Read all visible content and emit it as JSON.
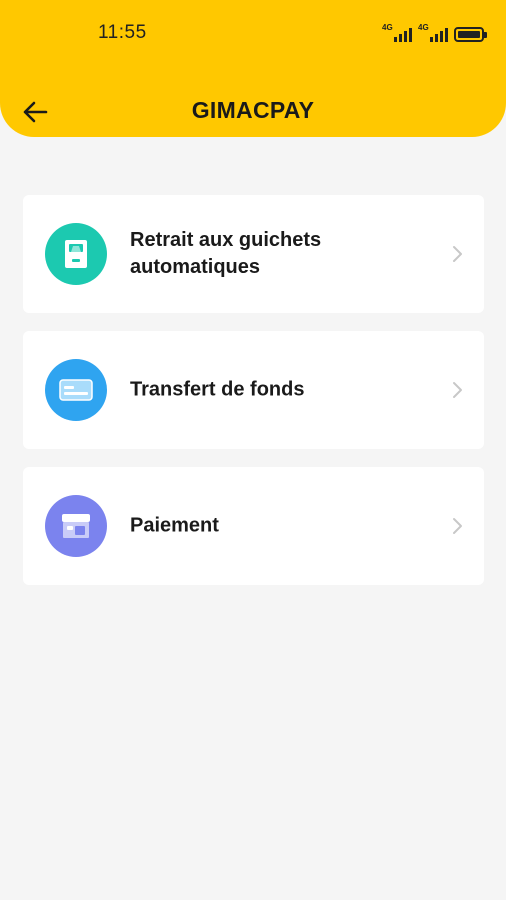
{
  "status_bar": {
    "time": "11:55",
    "network_1": "4G",
    "network_2": "4G",
    "icons": [
      "signal-icon",
      "signal-icon",
      "battery-icon"
    ]
  },
  "header": {
    "back_icon": "arrow-left-icon",
    "title": "GIMACPAY",
    "background_color": "#ffc800"
  },
  "menu": {
    "items": [
      {
        "label": "Retrait aux guichets automatiques",
        "icon": "atm-icon",
        "icon_color": "#1cc9b0"
      },
      {
        "label": "Transfert de fonds",
        "icon": "card-icon",
        "icon_color": "#2fa4f0"
      },
      {
        "label": "Paiement",
        "icon": "shop-icon",
        "icon_color": "#7b83ee"
      }
    ]
  }
}
